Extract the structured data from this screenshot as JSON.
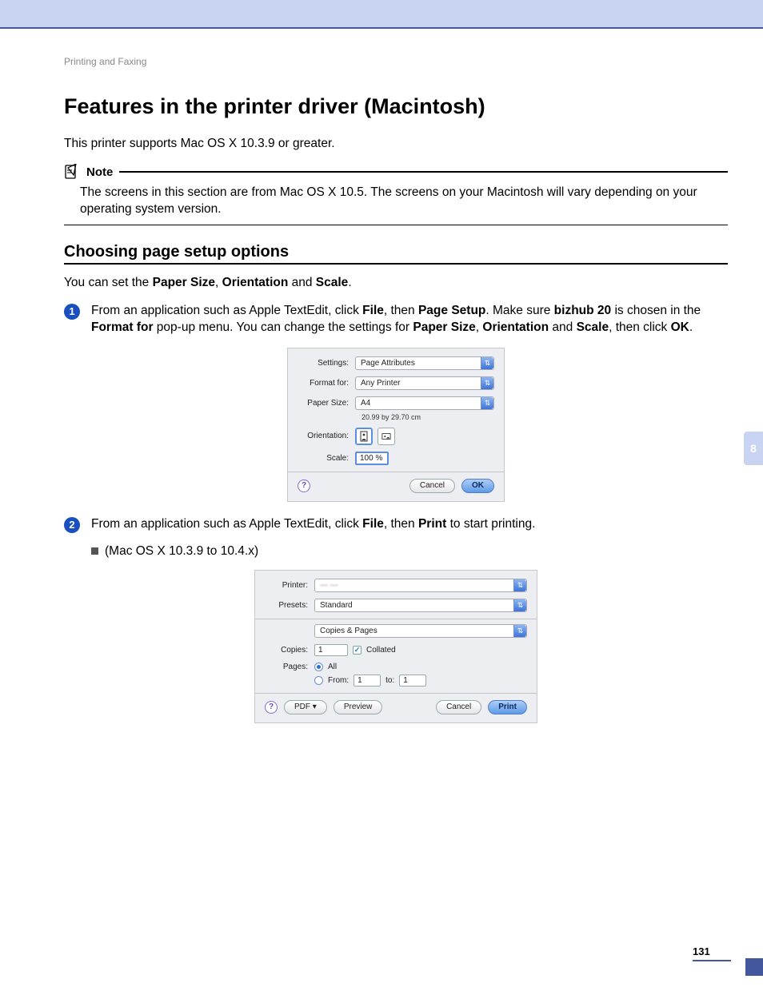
{
  "runningHead": "Printing and Faxing",
  "title": "Features in the printer driver (Macintosh)",
  "intro": "This printer supports Mac OS X 10.3.9 or greater.",
  "note": {
    "label": "Note",
    "text": "The screens in this section are from Mac OS X 10.5. The screens on your Macintosh will vary depending on your operating system version."
  },
  "section1": {
    "heading": "Choosing page setup options",
    "lead_pre": "You can set the ",
    "lead_b1": "Paper Size",
    "lead_sep1": ", ",
    "lead_b2": "Orientation",
    "lead_sep2": " and ",
    "lead_b3": "Scale",
    "lead_post": "."
  },
  "step1": {
    "num": "1",
    "t1": "From an application such as Apple TextEdit, click ",
    "b1": "File",
    "t2": ", then ",
    "b2": "Page Setup",
    "t3": ". Make sure ",
    "b3": "bizhub 20",
    "t4": " is chosen in the ",
    "b4": "Format for",
    "t5": " pop-up menu. You can change the settings for ",
    "b5": "Paper Size",
    "t6": ", ",
    "b6": "Orientation",
    "t7": " and ",
    "b7": "Scale",
    "t8": ", then click ",
    "b8": "OK",
    "t9": "."
  },
  "dlg1": {
    "settings_label": "Settings:",
    "settings_value": "Page Attributes",
    "format_label": "Format for:",
    "format_value": "Any Printer",
    "paper_label": "Paper Size:",
    "paper_value": "A4",
    "paper_dims": "20.99 by 29.70 cm",
    "orient_label": "Orientation:",
    "scale_label": "Scale:",
    "scale_value": "100 %",
    "cancel": "Cancel",
    "ok": "OK"
  },
  "step2": {
    "num": "2",
    "t1": "From an application such as Apple TextEdit, click ",
    "b1": "File",
    "t2": ", then ",
    "b2": "Print",
    "t3": " to start printing."
  },
  "bullet1": "(Mac OS X 10.3.9 to 10.4.x)",
  "dlg2": {
    "printer_label": "Printer:",
    "presets_label": "Presets:",
    "presets_value": "Standard",
    "panel_value": "Copies & Pages",
    "copies_label": "Copies:",
    "copies_value": "1",
    "collated": "Collated",
    "pages_label": "Pages:",
    "all": "All",
    "from": "From:",
    "from_value": "1",
    "to": "to:",
    "to_value": "1",
    "pdf": "PDF ▾",
    "preview": "Preview",
    "cancel": "Cancel",
    "print": "Print"
  },
  "sideTab": "8",
  "pageNumber": "131"
}
